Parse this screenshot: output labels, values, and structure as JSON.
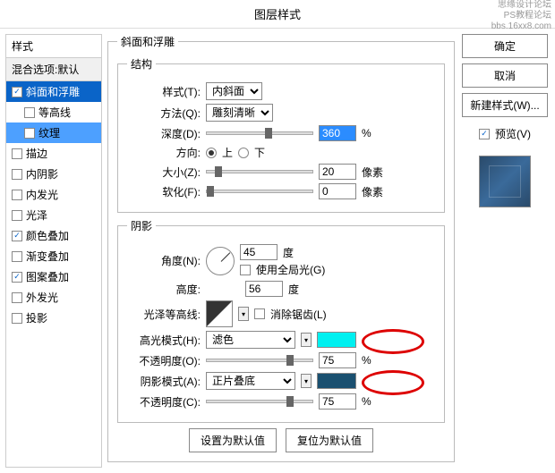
{
  "title": "图层样式",
  "watermark": {
    "line1": "思缘设计论坛",
    "line2": "PS教程论坛",
    "line3": "bbs.16xx8.com"
  },
  "sidebar": {
    "header": "样式",
    "blend": "混合选项:默认",
    "items": [
      {
        "label": "斜面和浮雕",
        "checked": true,
        "selected": true,
        "sub": false
      },
      {
        "label": "等高线",
        "checked": false,
        "selected": false,
        "sub": true
      },
      {
        "label": "纹理",
        "checked": false,
        "selected": true,
        "sub": true
      },
      {
        "label": "描边",
        "checked": false,
        "selected": false,
        "sub": false
      },
      {
        "label": "内阴影",
        "checked": false,
        "selected": false,
        "sub": false
      },
      {
        "label": "内发光",
        "checked": false,
        "selected": false,
        "sub": false
      },
      {
        "label": "光泽",
        "checked": false,
        "selected": false,
        "sub": false
      },
      {
        "label": "颜色叠加",
        "checked": true,
        "selected": false,
        "sub": false
      },
      {
        "label": "渐变叠加",
        "checked": false,
        "selected": false,
        "sub": false
      },
      {
        "label": "图案叠加",
        "checked": true,
        "selected": false,
        "sub": false
      },
      {
        "label": "外发光",
        "checked": false,
        "selected": false,
        "sub": false
      },
      {
        "label": "投影",
        "checked": false,
        "selected": false,
        "sub": false
      }
    ]
  },
  "bevel": {
    "section": "斜面和浮雕",
    "structure_label": "结构",
    "style_label": "样式(T):",
    "style_value": "内斜面",
    "technique_label": "方法(Q):",
    "technique_value": "雕刻清晰",
    "depth_label": "深度(D):",
    "depth_value": "360",
    "depth_unit": "%",
    "direction_label": "方向:",
    "up_label": "上",
    "down_label": "下",
    "size_label": "大小(Z):",
    "size_value": "20",
    "size_unit": "像素",
    "soften_label": "软化(F):",
    "soften_value": "0",
    "soften_unit": "像素"
  },
  "shading": {
    "section": "阴影",
    "angle_label": "角度(N):",
    "angle_value": "45",
    "angle_unit": "度",
    "global_label": "使用全局光(G)",
    "altitude_label": "高度:",
    "altitude_value": "56",
    "altitude_unit": "度",
    "gloss_label": "光泽等高线:",
    "antialias_label": "消除锯齿(L)",
    "highlight_mode_label": "高光模式(H):",
    "highlight_mode_value": "滤色",
    "highlight_opacity_label": "不透明度(O):",
    "highlight_opacity_value": "75",
    "highlight_opacity_unit": "%",
    "shadow_mode_label": "阴影模式(A):",
    "shadow_mode_value": "正片叠底",
    "shadow_opacity_label": "不透明度(C):",
    "shadow_opacity_value": "75",
    "shadow_opacity_unit": "%"
  },
  "bottom": {
    "default": "设置为默认值",
    "reset": "复位为默认值"
  },
  "right": {
    "ok": "确定",
    "cancel": "取消",
    "newstyle": "新建样式(W)...",
    "preview_label": "预览(V)"
  }
}
